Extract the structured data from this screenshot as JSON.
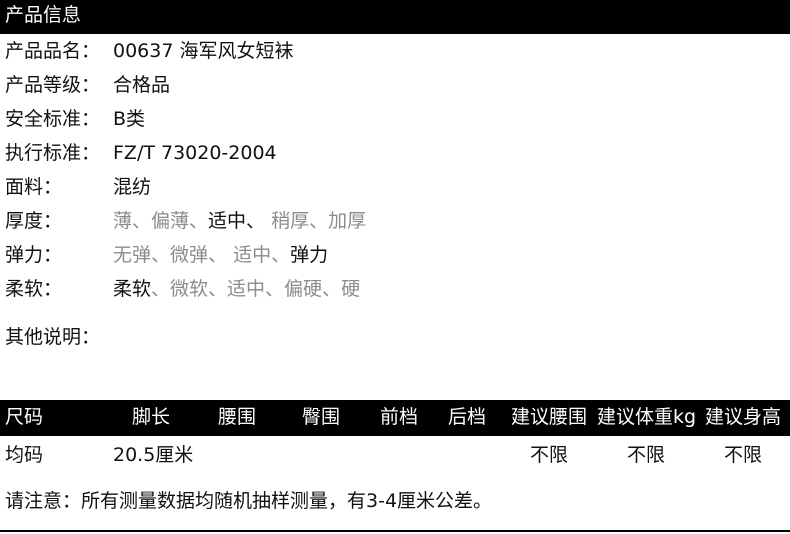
{
  "header": {
    "title": "产品信息"
  },
  "info": {
    "name": {
      "label": "产品品名：",
      "value": "00637 海军风女短袜"
    },
    "grade": {
      "label": "产品等级：",
      "value": "合格品"
    },
    "safety": {
      "label": "安全标准：",
      "value": "B类"
    },
    "standard": {
      "label": "执行标准：",
      "value": "FZ/T 73020-2004"
    },
    "fabric": {
      "label": "面料：",
      "value": "混纺"
    },
    "thickness": {
      "label": "厚度：",
      "options": [
        "薄、",
        "偏薄、",
        "适中、",
        " 稍厚、",
        "加厚"
      ],
      "selected": "适中"
    },
    "elasticity": {
      "label": "弹力：",
      "options": [
        "无弹、",
        "微弹、",
        " 适中、",
        "弹力"
      ],
      "selected": "弹力"
    },
    "softness": {
      "label": "柔软：",
      "options": [
        "柔软",
        "、微软、",
        "适中、",
        "偏硬、",
        "硬"
      ],
      "selected": "柔软"
    },
    "other": {
      "label": "其他说明："
    }
  },
  "size_table": {
    "headers": [
      "尺码",
      "脚长",
      "腰围",
      "臀围",
      "前档",
      "后档",
      "建议腰围",
      "建议体重kg",
      "建议身高"
    ],
    "rows": [
      [
        "均码",
        "20.5厘米",
        "",
        "",
        "",
        "",
        "不限",
        "不限",
        "不限"
      ]
    ]
  },
  "note": "请注意：所有测量数据均随机抽样测量，有3-4厘米公差。",
  "colors": {
    "header_bg": "#000000",
    "header_text": "#ffffff",
    "muted": "#8c8c8c"
  }
}
